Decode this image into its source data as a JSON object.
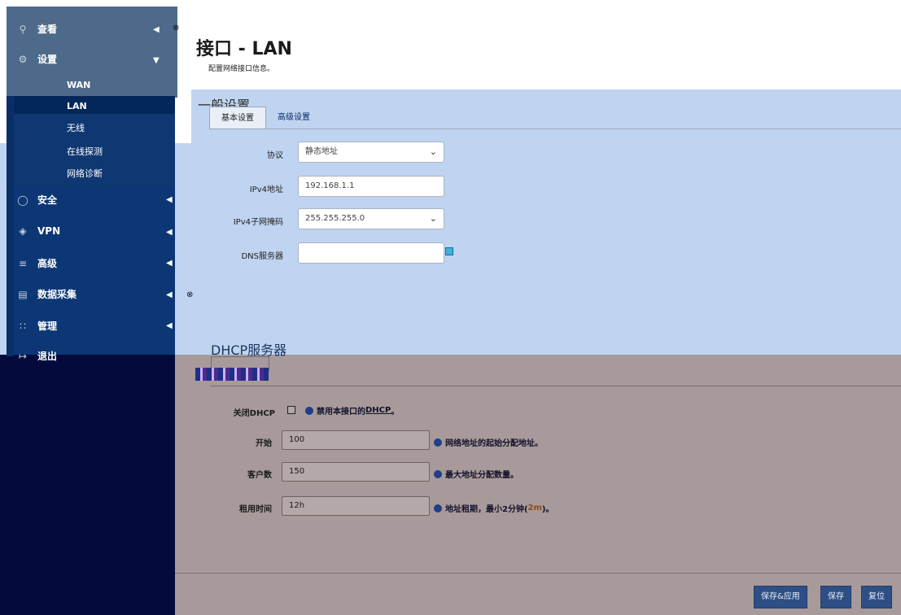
{
  "sidebar": {
    "view": "查看",
    "settings": "设置",
    "wan": "WAN",
    "lan": "LAN",
    "wireless": "无线",
    "online_probe": "在线探测",
    "net_diag": "网络诊断",
    "security": "安全",
    "vpn": "VPN",
    "advanced": "高级",
    "data_collect": "数据采集",
    "manage": "管理",
    "logout": "退出"
  },
  "header": {
    "title": "接口 - LAN",
    "description": "配置网络接口信息。"
  },
  "general": {
    "title": "一般设置",
    "tabs": [
      "基本设置",
      "高级设置"
    ],
    "protocol_label": "协议",
    "protocol_value": "静态地址",
    "ipv4_label": "IPv4地址",
    "ipv4_value": "192.168.1.1",
    "mask_label": "IPv4子网掩码",
    "mask_value": "255.255.255.0",
    "dns_label": "DNS服务器",
    "dns_value": ""
  },
  "dhcp": {
    "title": "DHCP服务器",
    "disable_label": "关闭DHCP",
    "disable_hint_prefix": "禁用本接口的",
    "disable_hint_link": "DHCP",
    "disable_hint_suffix": "。",
    "start_label": "开始",
    "start_value": "100",
    "start_hint": "网络地址的起始分配地址。",
    "clients_label": "客户数",
    "clients_value": "150",
    "clients_hint": "最大地址分配数量。",
    "lease_label": "租用时间",
    "lease_value": "12h",
    "lease_hint_prefix": "地址租期，最小2分钟(",
    "lease_hint_code": "2m",
    "lease_hint_suffix": ")。"
  },
  "footer": {
    "save_apply": "保存&应用",
    "save": "保存",
    "reset": "复位"
  },
  "icons": {
    "view": "search-icon",
    "settings": "gear-icon",
    "security": "shield-icon",
    "vpn": "vpn-shield-icon",
    "advanced": "sliders-icon",
    "data_collect": "database-icon",
    "manage": "grid-icon",
    "logout": "logout-icon"
  },
  "colors": {
    "sidebar": "#0c3774",
    "button": "#2d4f86",
    "panel": "#bfd4f0"
  }
}
